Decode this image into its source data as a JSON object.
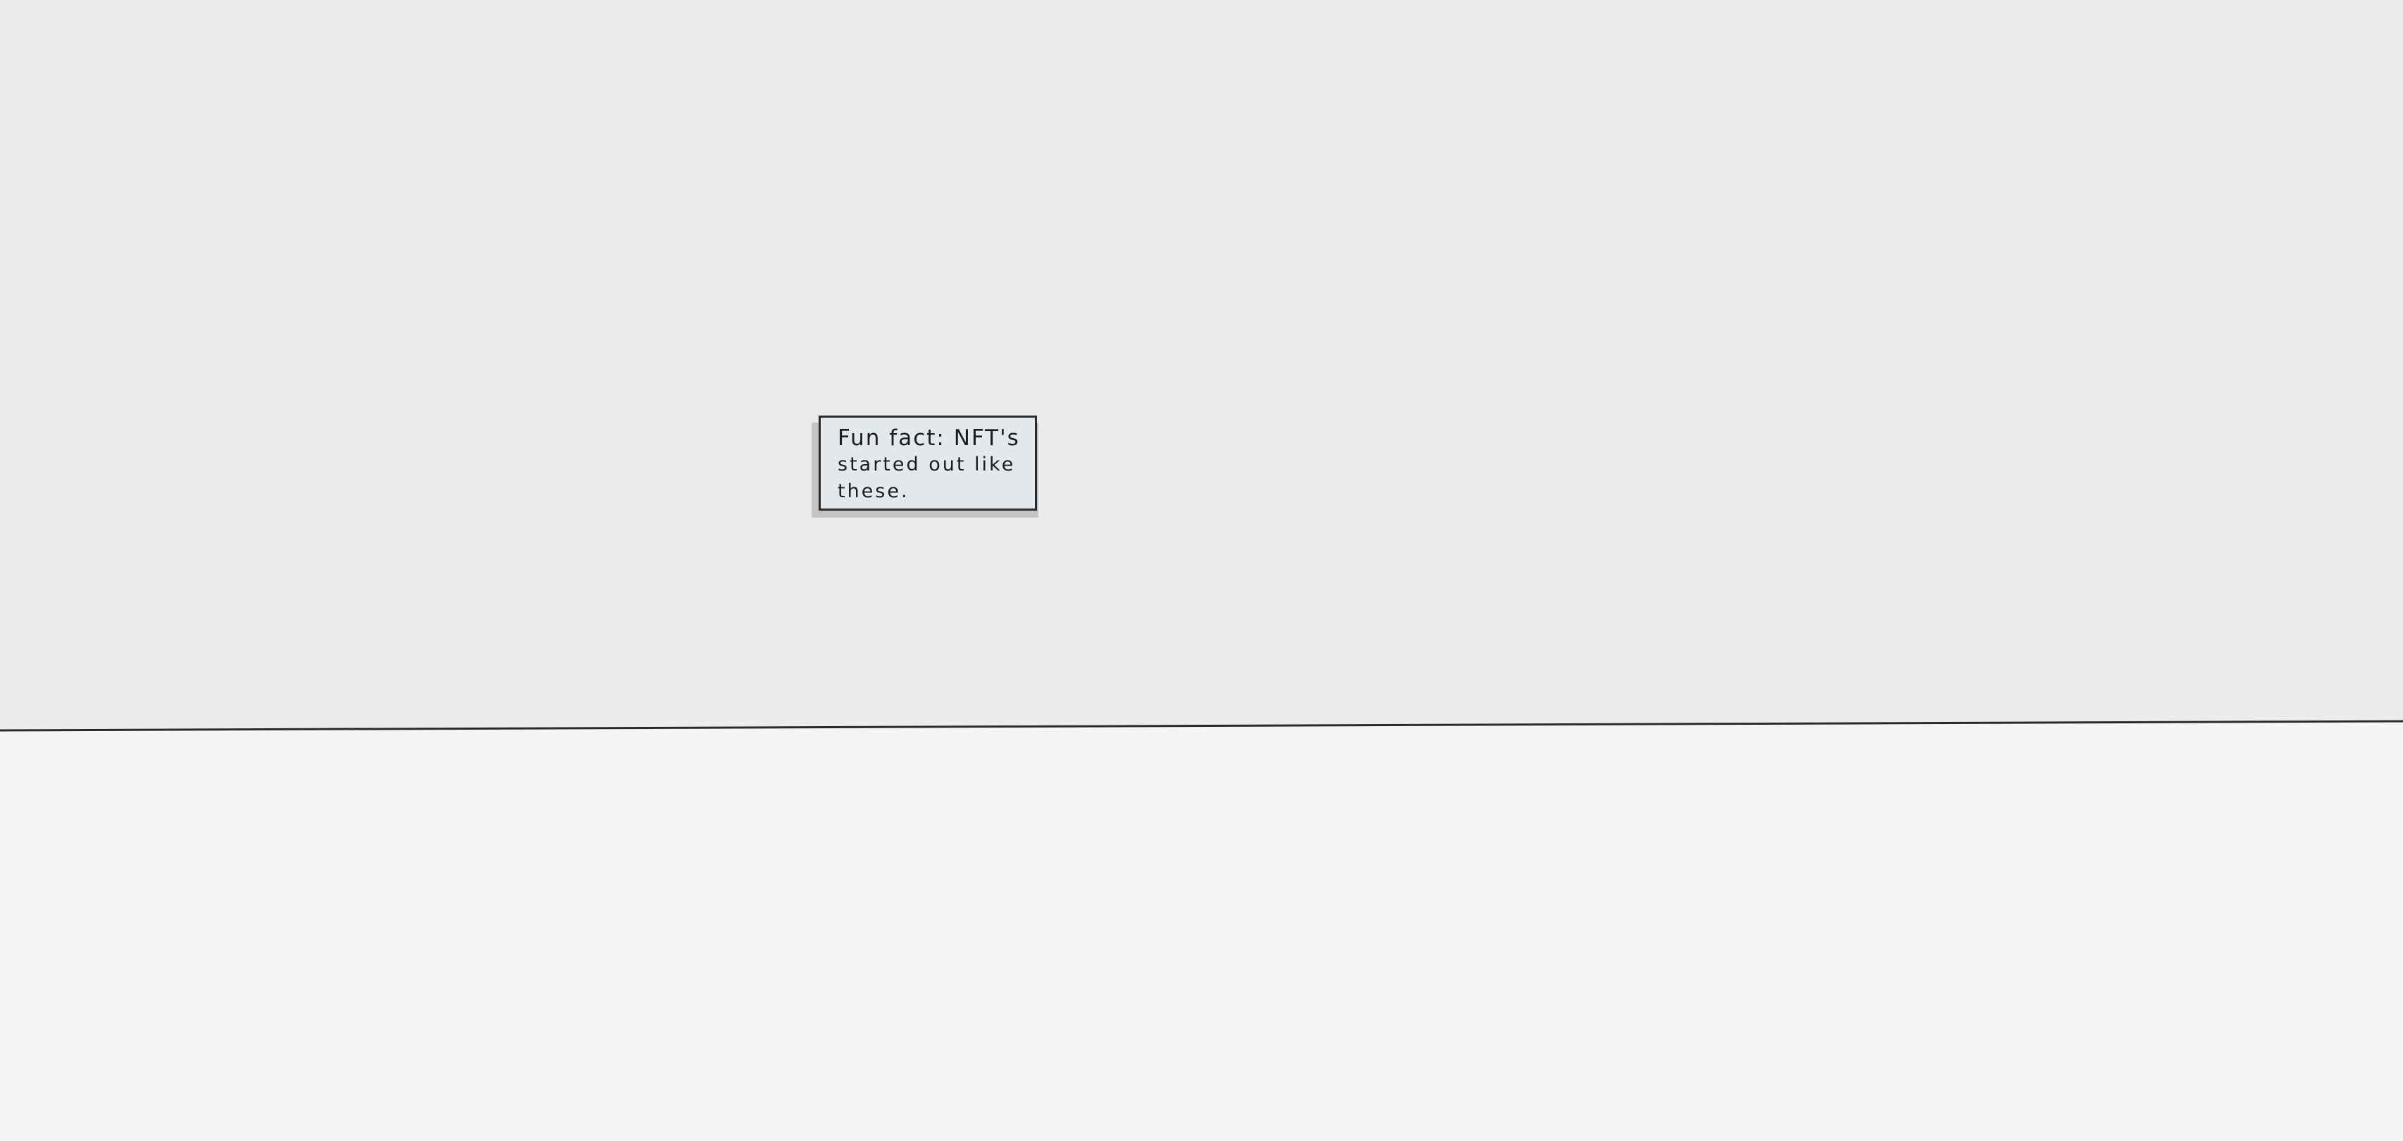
{
  "placard": {
    "line1": "Fun fact: NFT's",
    "line2": "started out like",
    "line3": "these."
  },
  "colors": {
    "wall": "#ececec",
    "floor": "#f5f5f5",
    "placard_bg": "#e3e8e8",
    "placard_border": "#2a2a2a",
    "shadow": "#c4c4c4",
    "horizon_line": "#2a2a2a"
  }
}
